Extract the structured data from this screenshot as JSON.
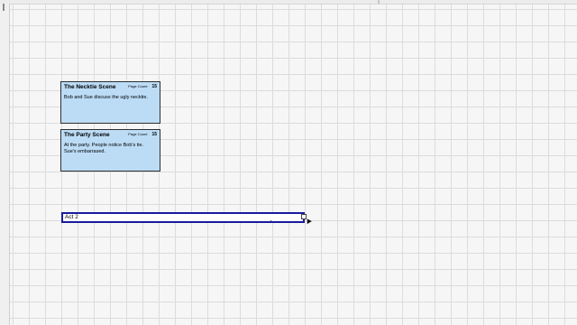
{
  "cards": [
    {
      "title": "The Necktie Scene",
      "page_count_label": "Page Count",
      "page_count_value": "15",
      "description": "Bob and Sue discuss the ugly necktie."
    },
    {
      "title": "The Party Scene",
      "page_count_label": "Page Count",
      "page_count_value": "15",
      "description": "At the party. People notice Bob's tie. Sue's embarrased."
    }
  ],
  "act_label": {
    "text": "Act 2"
  },
  "colors": {
    "card_fill": "#bcdcf6",
    "selection_border": "#1a1a9e",
    "grid_line": "#dcdcdc"
  }
}
